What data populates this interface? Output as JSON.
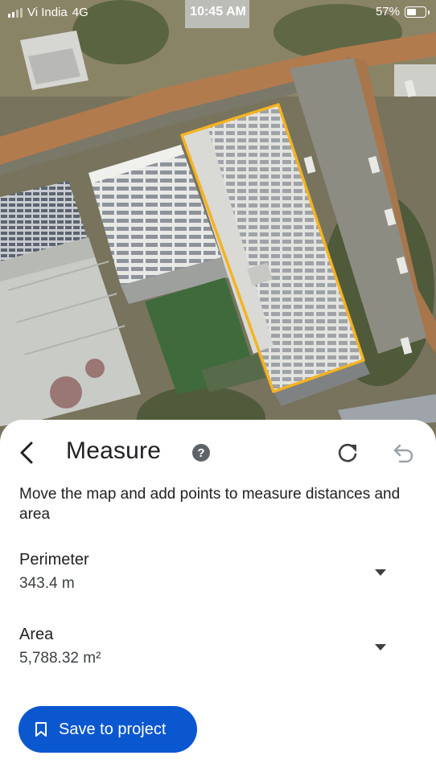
{
  "status_bar": {
    "carrier": "Vi India",
    "network": "4G",
    "time": "10:45 AM",
    "battery_percent_label": "57%",
    "battery_level": 0.57
  },
  "map": {
    "type": "satellite",
    "measured_polygon_color": "#f5b321"
  },
  "sheet": {
    "title": "Measure",
    "help_icon": "help-circle-icon",
    "instructions": "Move the map and add points to measure distances and area",
    "perimeter": {
      "label": "Perimeter",
      "value": "343.4 m"
    },
    "area": {
      "label": "Area",
      "value": "5,788.32 m²"
    },
    "save_button": {
      "label": "Save to project",
      "icon": "bookmark-icon",
      "color": "#0b57d0"
    }
  }
}
